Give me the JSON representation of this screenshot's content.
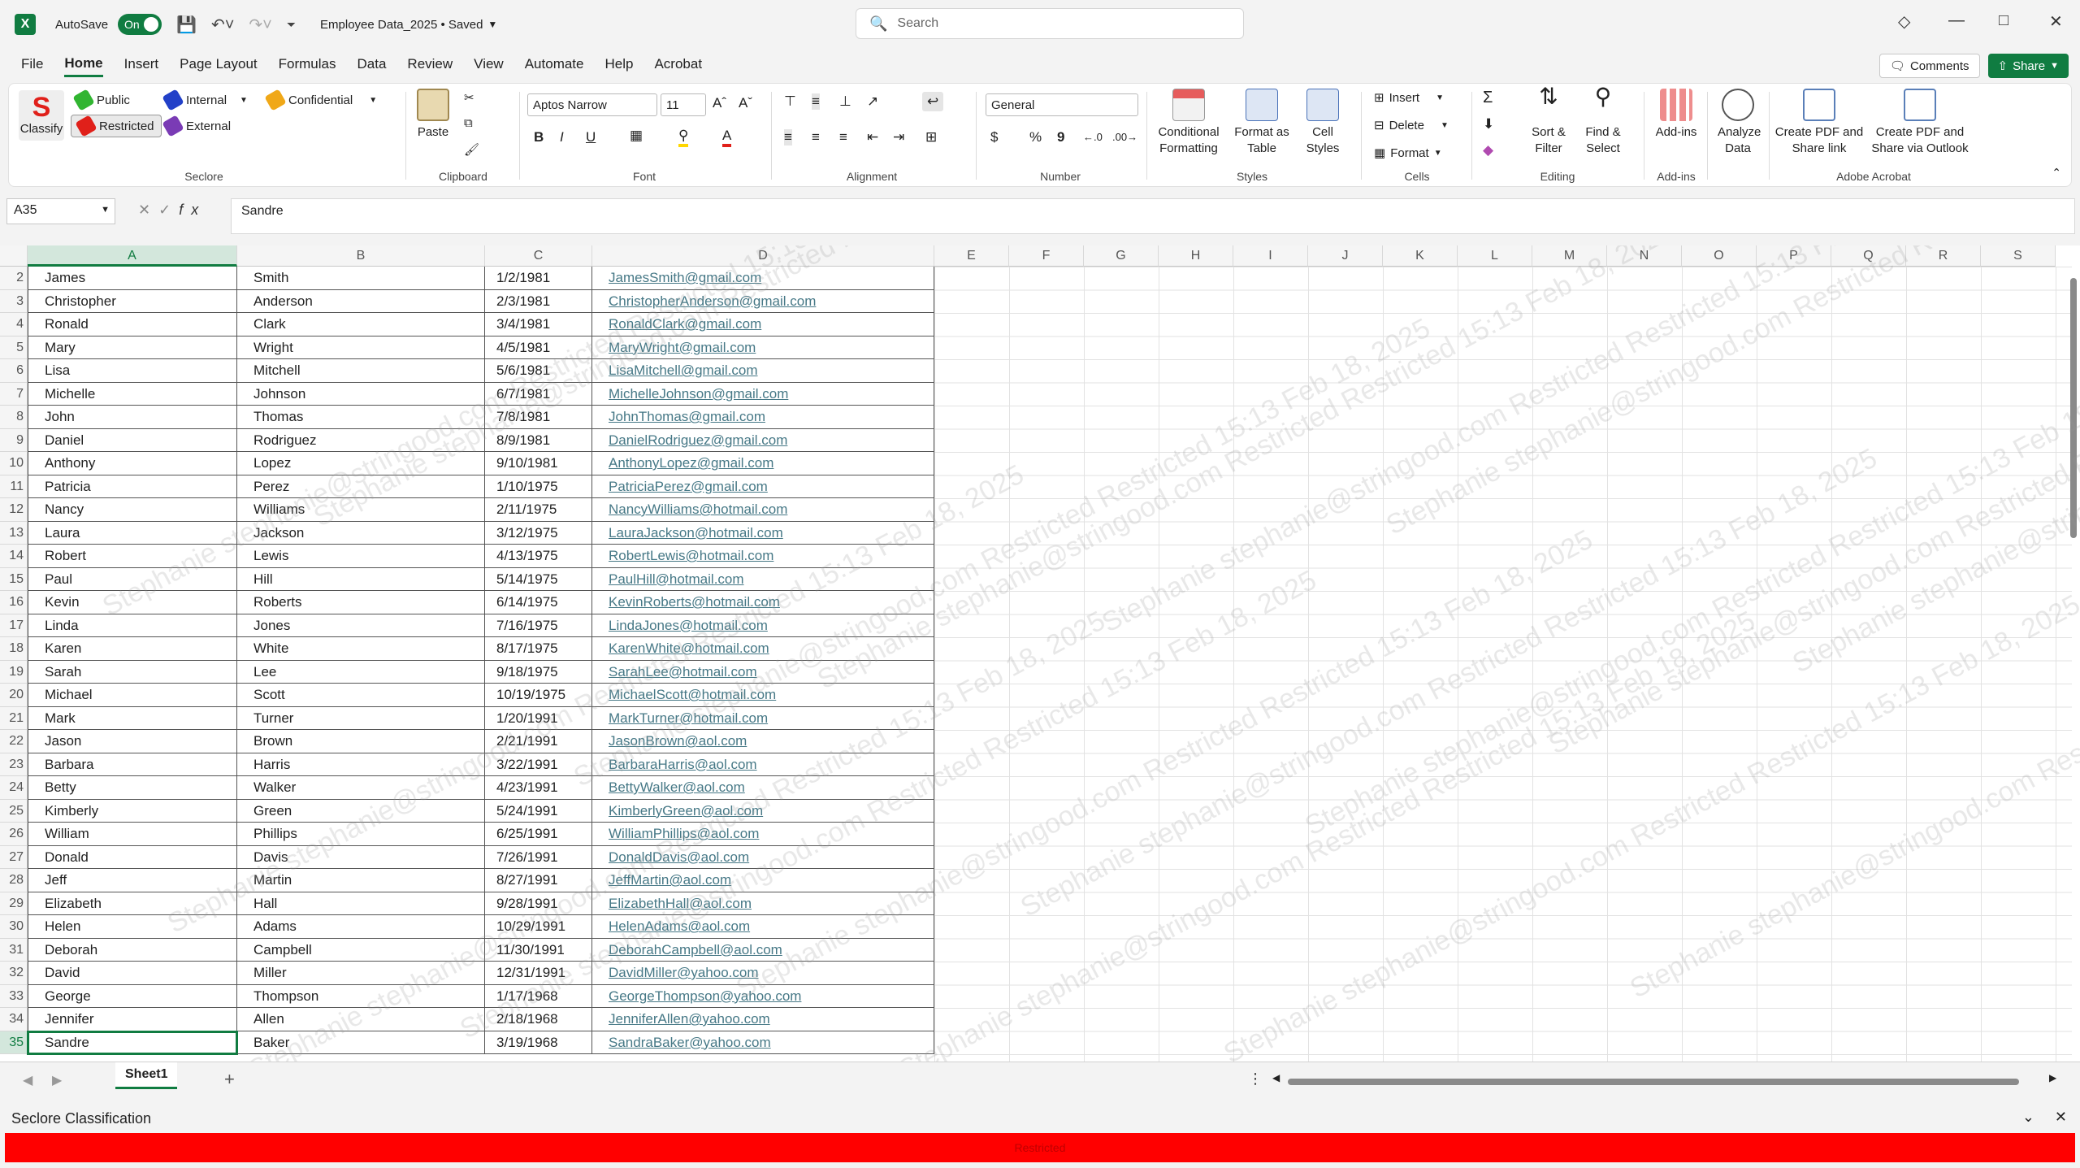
{
  "titlebar": {
    "autosave_label": "AutoSave",
    "autosave_state": "On",
    "document_title": "Employee Data_2025 • Saved",
    "search_placeholder": "Search"
  },
  "menu": {
    "tabs": [
      "File",
      "Home",
      "Insert",
      "Page Layout",
      "Formulas",
      "Data",
      "Review",
      "View",
      "Automate",
      "Help",
      "Acrobat"
    ],
    "active": "Home",
    "comments": "Comments",
    "share": "Share"
  },
  "ribbon": {
    "seclore": {
      "classify": "Classify",
      "public": "Public",
      "internal": "Internal",
      "confidential": "Confidential",
      "restricted": "Restricted",
      "external": "External",
      "label": "Seclore"
    },
    "clipboard": {
      "paste": "Paste",
      "label": "Clipboard"
    },
    "font": {
      "name": "Aptos Narrow",
      "size": "11",
      "label": "Font",
      "bold": "B",
      "italic": "I",
      "underline": "U"
    },
    "alignment": {
      "label": "Alignment"
    },
    "number": {
      "format": "General",
      "label": "Number",
      "currency": "$",
      "percent": "%",
      "comma": "9"
    },
    "styles": {
      "conditional": "Conditional Formatting",
      "format_table": "Format as Table",
      "cell_styles": "Cell Styles",
      "label": "Styles"
    },
    "cells": {
      "insert": "Insert",
      "delete": "Delete",
      "format": "Format",
      "label": "Cells"
    },
    "editing": {
      "sort": "Sort & Filter",
      "find": "Find & Select",
      "label": "Editing"
    },
    "addins": {
      "addins": "Add-ins",
      "label": "Add-ins"
    },
    "analyze": {
      "label": "Analyze Data"
    },
    "acrobat": {
      "create_share": "Create PDF and Share link",
      "create_outlook": "Create PDF and Share via Outlook",
      "label": "Adobe Acrobat"
    }
  },
  "formula_bar": {
    "name_box": "A35",
    "content": "Sandre"
  },
  "columns": [
    "A",
    "B",
    "C",
    "D",
    "E",
    "F",
    "G",
    "H",
    "I",
    "J",
    "K",
    "L",
    "M",
    "N",
    "O",
    "P",
    "Q",
    "R",
    "S"
  ],
  "rows": [
    {
      "n": "2",
      "first": "James",
      "last": "Smith",
      "date": "1/2/1981",
      "email": "JamesSmith@gmail.com"
    },
    {
      "n": "3",
      "first": "Christopher",
      "last": "Anderson",
      "date": "2/3/1981",
      "email": "ChristopherAnderson@gmail.com"
    },
    {
      "n": "4",
      "first": "Ronald",
      "last": "Clark",
      "date": "3/4/1981",
      "email": "RonaldClark@gmail.com"
    },
    {
      "n": "5",
      "first": "Mary",
      "last": "Wright",
      "date": "4/5/1981",
      "email": "MaryWright@gmail.com"
    },
    {
      "n": "6",
      "first": "Lisa",
      "last": "Mitchell",
      "date": "5/6/1981",
      "email": "LisaMitchell@gmail.com"
    },
    {
      "n": "7",
      "first": "Michelle",
      "last": "Johnson",
      "date": "6/7/1981",
      "email": "MichelleJohnson@gmail.com"
    },
    {
      "n": "8",
      "first": "John",
      "last": "Thomas",
      "date": "7/8/1981",
      "email": "JohnThomas@gmail.com"
    },
    {
      "n": "9",
      "first": "Daniel",
      "last": "Rodriguez",
      "date": "8/9/1981",
      "email": "DanielRodriguez@gmail.com"
    },
    {
      "n": "10",
      "first": "Anthony",
      "last": "Lopez",
      "date": "9/10/1981",
      "email": "AnthonyLopez@gmail.com"
    },
    {
      "n": "11",
      "first": "Patricia",
      "last": "Perez",
      "date": "1/10/1975",
      "email": "PatriciaPerez@gmail.com"
    },
    {
      "n": "12",
      "first": "Nancy",
      "last": "Williams",
      "date": "2/11/1975",
      "email": "NancyWilliams@hotmail.com"
    },
    {
      "n": "13",
      "first": "Laura",
      "last": "Jackson",
      "date": "3/12/1975",
      "email": "LauraJackson@hotmail.com"
    },
    {
      "n": "14",
      "first": "Robert",
      "last": "Lewis",
      "date": "4/13/1975",
      "email": "RobertLewis@hotmail.com"
    },
    {
      "n": "15",
      "first": "Paul",
      "last": "Hill",
      "date": "5/14/1975",
      "email": "PaulHill@hotmail.com"
    },
    {
      "n": "16",
      "first": "Kevin",
      "last": "Roberts",
      "date": "6/14/1975",
      "email": "KevinRoberts@hotmail.com"
    },
    {
      "n": "17",
      "first": "Linda",
      "last": "Jones",
      "date": "7/16/1975",
      "email": "LindaJones@hotmail.com"
    },
    {
      "n": "18",
      "first": "Karen",
      "last": "White",
      "date": "8/17/1975",
      "email": "KarenWhite@hotmail.com"
    },
    {
      "n": "19",
      "first": "Sarah",
      "last": "Lee",
      "date": "9/18/1975",
      "email": "SarahLee@hotmail.com"
    },
    {
      "n": "20",
      "first": "Michael",
      "last": "Scott",
      "date": "10/19/1975",
      "email": "MichaelScott@hotmail.com"
    },
    {
      "n": "21",
      "first": "Mark",
      "last": "Turner",
      "date": "1/20/1991",
      "email": "MarkTurner@hotmail.com"
    },
    {
      "n": "22",
      "first": "Jason",
      "last": "Brown",
      "date": "2/21/1991",
      "email": "JasonBrown@aol.com"
    },
    {
      "n": "23",
      "first": "Barbara",
      "last": "Harris",
      "date": "3/22/1991",
      "email": "BarbaraHarris@aol.com"
    },
    {
      "n": "24",
      "first": "Betty",
      "last": "Walker",
      "date": "4/23/1991",
      "email": "BettyWalker@aol.com"
    },
    {
      "n": "25",
      "first": "Kimberly",
      "last": "Green",
      "date": "5/24/1991",
      "email": "KimberlyGreen@aol.com"
    },
    {
      "n": "26",
      "first": "William",
      "last": "Phillips",
      "date": "6/25/1991",
      "email": "WilliamPhillips@aol.com"
    },
    {
      "n": "27",
      "first": "Donald",
      "last": "Davis",
      "date": "7/26/1991",
      "email": "DonaldDavis@aol.com"
    },
    {
      "n": "28",
      "first": "Jeff",
      "last": "Martin",
      "date": "8/27/1991",
      "email": "JeffMartin@aol.com"
    },
    {
      "n": "29",
      "first": "Elizabeth",
      "last": "Hall",
      "date": "9/28/1991",
      "email": "ElizabethHall@aol.com"
    },
    {
      "n": "30",
      "first": "Helen",
      "last": "Adams",
      "date": "10/29/1991",
      "email": "HelenAdams@aol.com"
    },
    {
      "n": "31",
      "first": "Deborah",
      "last": "Campbell",
      "date": "11/30/1991",
      "email": "DeborahCampbell@aol.com"
    },
    {
      "n": "32",
      "first": "David",
      "last": "Miller",
      "date": "12/31/1991",
      "email": "DavidMiller@yahoo.com"
    },
    {
      "n": "33",
      "first": "George",
      "last": "Thompson",
      "date": "1/17/1968",
      "email": "GeorgeThompson@yahoo.com"
    },
    {
      "n": "34",
      "first": "Jennifer",
      "last": "Allen",
      "date": "2/18/1968",
      "email": "JenniferAllen@yahoo.com"
    },
    {
      "n": "35",
      "first": "Sandre",
      "last": "Baker",
      "date": "3/19/1968",
      "email": "SandraBaker@yahoo.com"
    }
  ],
  "watermark_text": "Stephanie stephanie@stringood.com Restricted Restricted 15:13 Feb 18, 2025",
  "sheet_tab": "Sheet1",
  "seclore_bar": {
    "title": "Seclore Classification",
    "status": "Restricted"
  },
  "colors": {
    "excel_green": "#107c41",
    "restricted_red": "#ff0000",
    "link": "#467886"
  }
}
